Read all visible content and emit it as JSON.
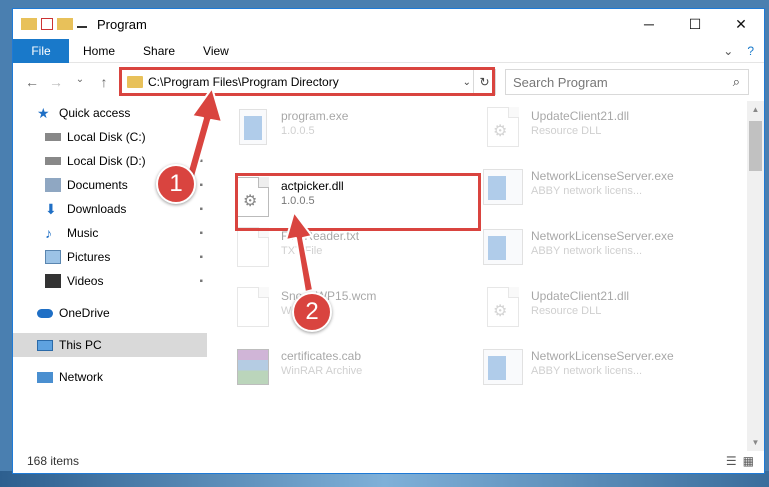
{
  "window": {
    "title": "Program",
    "controls": {
      "minimize": "─",
      "maximize": "☐",
      "close": "✕"
    }
  },
  "ribbon": {
    "file": "File",
    "tabs": [
      "Home",
      "Share",
      "View"
    ],
    "expand": "⌄",
    "help": "?"
  },
  "nav": {
    "back": "←",
    "forward": "→",
    "recent": "⌄",
    "up": "↑"
  },
  "address": {
    "path": "C:\\Program Files\\Program Directory",
    "chevron": "⌄",
    "refresh": "↻"
  },
  "search": {
    "placeholder": "Search Program",
    "icon": "⌕"
  },
  "sidebar": {
    "items": [
      {
        "label": "Quick access",
        "icon": "star-icon",
        "color": "#1f6fc5"
      },
      {
        "label": "Local Disk (C:)",
        "icon": "drive-icon",
        "pinned": true
      },
      {
        "label": "Local Disk (D:)",
        "icon": "drive-icon",
        "pinned": true
      },
      {
        "label": "Documents",
        "icon": "documents-icon",
        "pinned": true
      },
      {
        "label": "Downloads",
        "icon": "downloads-icon",
        "pinned": true
      },
      {
        "label": "Music",
        "icon": "music-icon",
        "pinned": true
      },
      {
        "label": "Pictures",
        "icon": "pictures-icon",
        "pinned": true
      },
      {
        "label": "Videos",
        "icon": "videos-icon",
        "pinned": true
      },
      {
        "label": "OneDrive",
        "icon": "onedrive-icon"
      },
      {
        "label": "This PC",
        "icon": "pc-icon",
        "selected": true
      },
      {
        "label": "Network",
        "icon": "network-icon"
      }
    ],
    "pin_glyph": "📌"
  },
  "files": {
    "left": [
      {
        "name": "program.exe",
        "desc": "1.0.0.5",
        "icon": "exe-icon"
      },
      {
        "name": "actpicker.dll",
        "desc": "1.0.0.5",
        "icon": "dll-gear-icon",
        "highlighted": true
      },
      {
        "name": "FineReader.txt",
        "desc": "TXT File",
        "icon": "text-file-icon"
      },
      {
        "name": "SnoopWP15.wcm",
        "desc": "WCM File",
        "icon": "blank-file-icon"
      },
      {
        "name": "certificates.cab",
        "desc": "WinRAR Archive",
        "icon": "rar-icon"
      }
    ],
    "right": [
      {
        "name": "UpdateClient21.dll",
        "desc": "Resource DLL",
        "icon": "dll-gear-icon"
      },
      {
        "name": "NetworkLicenseServer.exe",
        "desc": "ABBY network licens...",
        "icon": "app-window-icon"
      },
      {
        "name": "NetworkLicenseServer.exe",
        "desc": "ABBY network licens...",
        "icon": "app-window-icon"
      },
      {
        "name": "UpdateClient21.dll",
        "desc": "Resource DLL",
        "icon": "dll-gear-icon"
      },
      {
        "name": "NetworkLicenseServer.exe",
        "desc": "ABBY network licens...",
        "icon": "app-window-icon"
      }
    ]
  },
  "status": {
    "count": "168 items"
  },
  "callouts": [
    "1",
    "2"
  ],
  "colors": {
    "accent": "#1979ca",
    "highlight": "#d9443f"
  }
}
